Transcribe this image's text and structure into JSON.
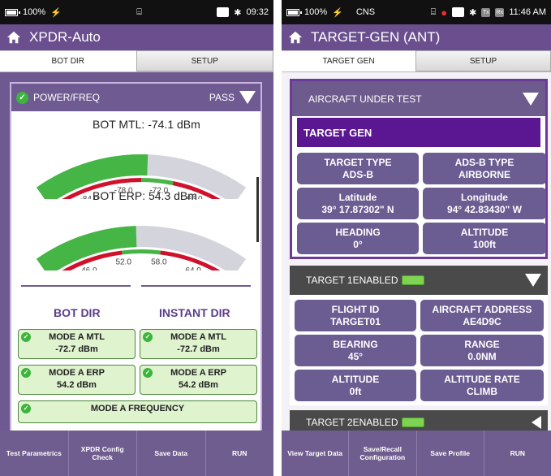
{
  "left": {
    "status": {
      "battery": "100%",
      "time": "09:32"
    },
    "title": "XPDR-Auto",
    "tabs": [
      "BOT DIR",
      "SETUP"
    ],
    "power_freq": {
      "label": "POWER/FREQ",
      "result": "PASS"
    },
    "mtl": {
      "label": "BOT MTL: -74.1 dBm",
      "min": -90,
      "max": -60,
      "value": -74.1,
      "low_limit": -75,
      "high_limit": -70,
      "ticks": [
        "-90",
        "-84.0",
        "-78.0",
        "-72.0",
        "-66.0",
        "-60"
      ]
    },
    "erp": {
      "label": "BOT ERP: 54.3 dBm",
      "min": 40,
      "max": 70,
      "value": 54.3,
      "low_limit": 52,
      "high_limit": 58,
      "ticks": [
        "40",
        "46.0",
        "52.0",
        "58.0",
        "64.0",
        "70"
      ]
    },
    "columns": [
      "BOT DIR",
      "INSTANT DIR"
    ],
    "boxes": [
      {
        "title": "MODE A MTL",
        "value": "-72.7 dBm"
      },
      {
        "title": "MODE A MTL",
        "value": "-72.7 dBm"
      },
      {
        "title": "MODE A ERP",
        "value": "54.2 dBm"
      },
      {
        "title": "MODE A ERP",
        "value": "54.2 dBm"
      }
    ],
    "frequency_label": "MODE A FREQUENCY",
    "buttons": [
      "Test Parametrics",
      "XPDR Config Check",
      "Save Data",
      "RUN"
    ],
    "colors": {
      "green": "#45b545",
      "red": "#d0112b",
      "track": "#d4d4dc"
    }
  },
  "right": {
    "status": {
      "battery": "100%",
      "network": "CNS",
      "time": "11:46 AM",
      "tx": "Tx",
      "rx": "Rx"
    },
    "title": "TARGET-GEN (ANT)",
    "tabs": [
      "TARGET GEN",
      "SETUP"
    ],
    "aircraft_label": "AIRCRAFT UNDER TEST",
    "target_gen_label": "TARGET GEN",
    "aircraft_cells": [
      {
        "label": "TARGET TYPE",
        "value": "ADS-B"
      },
      {
        "label": "ADS-B TYPE",
        "value": "AIRBORNE"
      },
      {
        "label": "Latitude",
        "value": "39° 17.87302\" N"
      },
      {
        "label": "Longitude",
        "value": "94° 42.83430\" W"
      },
      {
        "label": "HEADING",
        "value": "0°"
      },
      {
        "label": "ALTITUDE",
        "value": "100ft"
      }
    ],
    "target1_label": "TARGET 1ENABLED",
    "target1_cells": [
      {
        "label": "FLIGHT ID",
        "value": "TARGET01"
      },
      {
        "label": "AIRCRAFT ADDRESS",
        "value": "AE4D9C"
      },
      {
        "label": "BEARING",
        "value": "45°"
      },
      {
        "label": "RANGE",
        "value": "0.0NM"
      },
      {
        "label": "ALTITUDE",
        "value": "0ft"
      },
      {
        "label": "ALTITUDE RATE",
        "value": "CLIMB"
      }
    ],
    "target2_label": "TARGET 2ENABLED",
    "buttons": [
      "View Target Data",
      "Save/Recall Configuration",
      "Save Profile",
      "RUN"
    ]
  }
}
